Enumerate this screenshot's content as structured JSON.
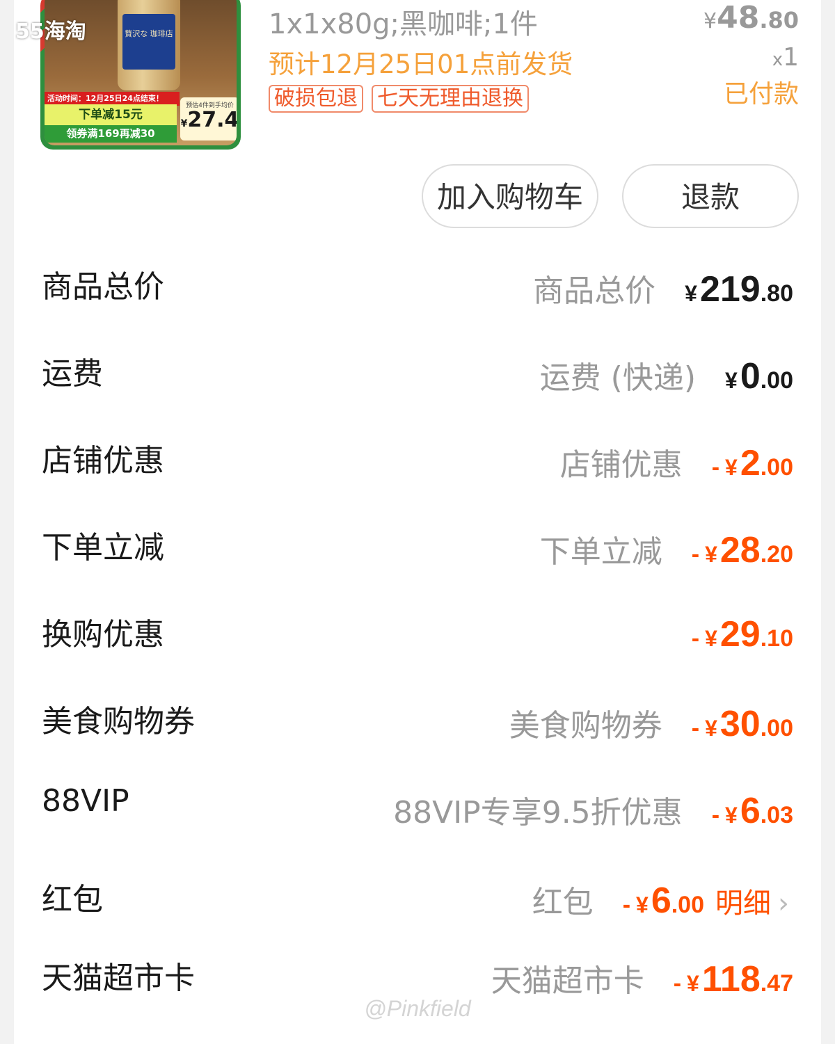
{
  "watermark": {
    "logo": "55海淘",
    "user": "@Pinkfield"
  },
  "product": {
    "image": {
      "jar_label": "贅沢な 珈琲店",
      "promo_time": "活动时间：12月25日24点结束！",
      "promo_main": "下单减15元",
      "promo_sub": "领券满169再减30",
      "promo_price_note": "预估4件到手均价",
      "promo_price_currency": "¥",
      "promo_price": "27.4"
    },
    "spec": "1x1x80g;黑咖啡;1件",
    "shipping": "预计12月25日01点前发货",
    "tags": [
      "破损包退",
      "七天无理由退换"
    ],
    "price": {
      "currency": "¥",
      "int": "48",
      "dec": ".80"
    },
    "qty_prefix": "x",
    "qty": "1",
    "status": "已付款"
  },
  "buttons": {
    "add_cart": "加入购物车",
    "refund": "退款"
  },
  "rows": [
    {
      "label": "商品总价",
      "desc": "商品总价",
      "minus": "",
      "cur": "¥",
      "int": "219",
      "dec": ".80"
    },
    {
      "label": "运费",
      "desc": "运费 (快递)",
      "minus": "",
      "cur": "¥",
      "int": "0",
      "dec": ".00"
    },
    {
      "label": "店铺优惠",
      "desc": "店铺优惠",
      "minus": "-",
      "cur": "¥",
      "int": "2",
      "dec": ".00"
    },
    {
      "label": "下单立减",
      "desc": "下单立减",
      "minus": "-",
      "cur": "¥",
      "int": "28",
      "dec": ".20"
    },
    {
      "label": "换购优惠",
      "desc": "",
      "minus": "-",
      "cur": "¥",
      "int": "29",
      "dec": ".10"
    },
    {
      "label": "美食购物券",
      "desc": "美食购物券",
      "minus": "-",
      "cur": "¥",
      "int": "30",
      "dec": ".00"
    },
    {
      "label": "88VIP",
      "desc": "88VIP专享9.5折优惠",
      "minus": "-",
      "cur": "¥",
      "int": "6",
      "dec": ".03"
    },
    {
      "label": "红包",
      "desc": "红包",
      "minus": "-",
      "cur": "¥",
      "int": "6",
      "dec": ".00",
      "detail": "明细"
    },
    {
      "label": "天猫超市卡",
      "desc": "天猫超市卡",
      "minus": "-",
      "cur": "¥",
      "int": "118",
      "dec": ".47"
    }
  ],
  "colors": {
    "accent": "#ff5000",
    "shipping": "#f5a13b",
    "muted": "#999999",
    "tag_border": "#f08a6a"
  }
}
